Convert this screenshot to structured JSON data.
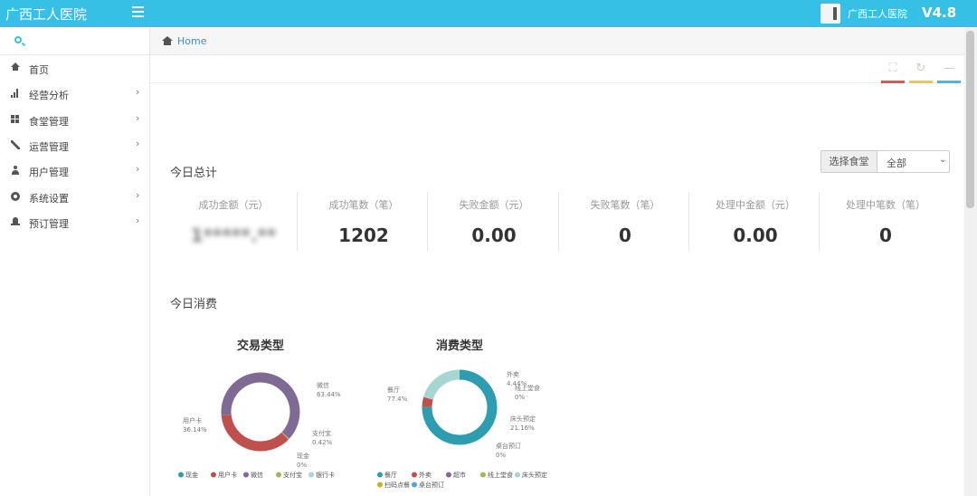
{
  "header": {
    "brand": "广西工人医院",
    "user_name": "广西工人医院",
    "version": "V4.8"
  },
  "breadcrumb": {
    "home": "Home"
  },
  "sidebar": {
    "items": [
      {
        "label": "首页",
        "icon": "home-icon",
        "has_arrow": false
      },
      {
        "label": "经营分析",
        "icon": "bar-chart-icon",
        "has_arrow": true
      },
      {
        "label": "食堂管理",
        "icon": "grid-icon",
        "has_arrow": true
      },
      {
        "label": "运营管理",
        "icon": "wrench-icon",
        "has_arrow": true
      },
      {
        "label": "用户管理",
        "icon": "user-icon",
        "has_arrow": true
      },
      {
        "label": "系统设置",
        "icon": "gear-icon",
        "has_arrow": true
      },
      {
        "label": "预订管理",
        "icon": "bell-icon",
        "has_arrow": true
      }
    ],
    "arrow": "›"
  },
  "tools": {
    "colors": [
      "#e0584b",
      "#f0c64b",
      "#36c0e6"
    ]
  },
  "summary": {
    "title": "今日总计",
    "select_label": "选择食堂",
    "select_value": "全部",
    "stats": [
      {
        "label": "成功金额（元）",
        "value": "1*****.**",
        "blurred": true
      },
      {
        "label": "成功笔数（笔）",
        "value": "1202"
      },
      {
        "label": "失败金额（元）",
        "value": "0.00"
      },
      {
        "label": "失败笔数（笔）",
        "value": "0"
      },
      {
        "label": "处理中金额（元）",
        "value": "0.00"
      },
      {
        "label": "处理中笔数（笔）",
        "value": "0"
      }
    ]
  },
  "consumption": {
    "title": "今日消费"
  },
  "chart_data": [
    {
      "type": "pie",
      "title": "交易类型",
      "donut": true,
      "slices": [
        {
          "name": "现金",
          "value": 0,
          "color": "#2e9db0"
        },
        {
          "name": "用户卡",
          "value": 36.14,
          "color": "#c0504d"
        },
        {
          "name": "微信",
          "value": 63.44,
          "color": "#7f6a93"
        },
        {
          "name": "支付宝",
          "value": 0.42,
          "color": "#9bbb59"
        },
        {
          "name": "银行卡",
          "value": 0,
          "color": "#a5d6d1"
        }
      ],
      "annotations": [
        {
          "name": "微信",
          "pct": "63.44%"
        },
        {
          "name": "用户卡",
          "pct": "36.14%"
        },
        {
          "name": "支付宝",
          "pct": "0.42%"
        },
        {
          "name": "现金",
          "pct": "0%"
        }
      ],
      "legend": [
        "现金",
        "用户卡",
        "微信",
        "支付宝",
        "银行卡"
      ],
      "legend_position": "bottom"
    },
    {
      "type": "pie",
      "title": "消费类型",
      "donut": true,
      "slices": [
        {
          "name": "餐厅",
          "value": 77.4,
          "color": "#2e9db0"
        },
        {
          "name": "外卖",
          "value": 4.44,
          "color": "#c0504d"
        },
        {
          "name": "超市",
          "value": 0,
          "color": "#7f6a93"
        },
        {
          "name": "线上堂食",
          "value": 0,
          "color": "#9bbb59"
        },
        {
          "name": "床头预定",
          "value": 21.16,
          "color": "#a5d6d1"
        },
        {
          "name": "扫码点餐",
          "value": 0,
          "color": "#c8b420"
        },
        {
          "name": "桌台预订",
          "value": 0,
          "color": "#4ea6dc"
        }
      ],
      "annotations": [
        {
          "name": "外卖",
          "pct": "4.44%"
        },
        {
          "name": "线上堂食",
          "pct": "0%"
        },
        {
          "name": "餐厅",
          "pct": "77.4%"
        },
        {
          "name": "床头预定",
          "pct": "21.16%"
        },
        {
          "name": "桌台预订",
          "pct": "0%"
        }
      ],
      "legend": [
        "餐厅",
        "外卖",
        "超市",
        "线上堂食",
        "床头预定",
        "扫码点餐",
        "桌台预订"
      ],
      "legend_position": "bottom"
    }
  ]
}
